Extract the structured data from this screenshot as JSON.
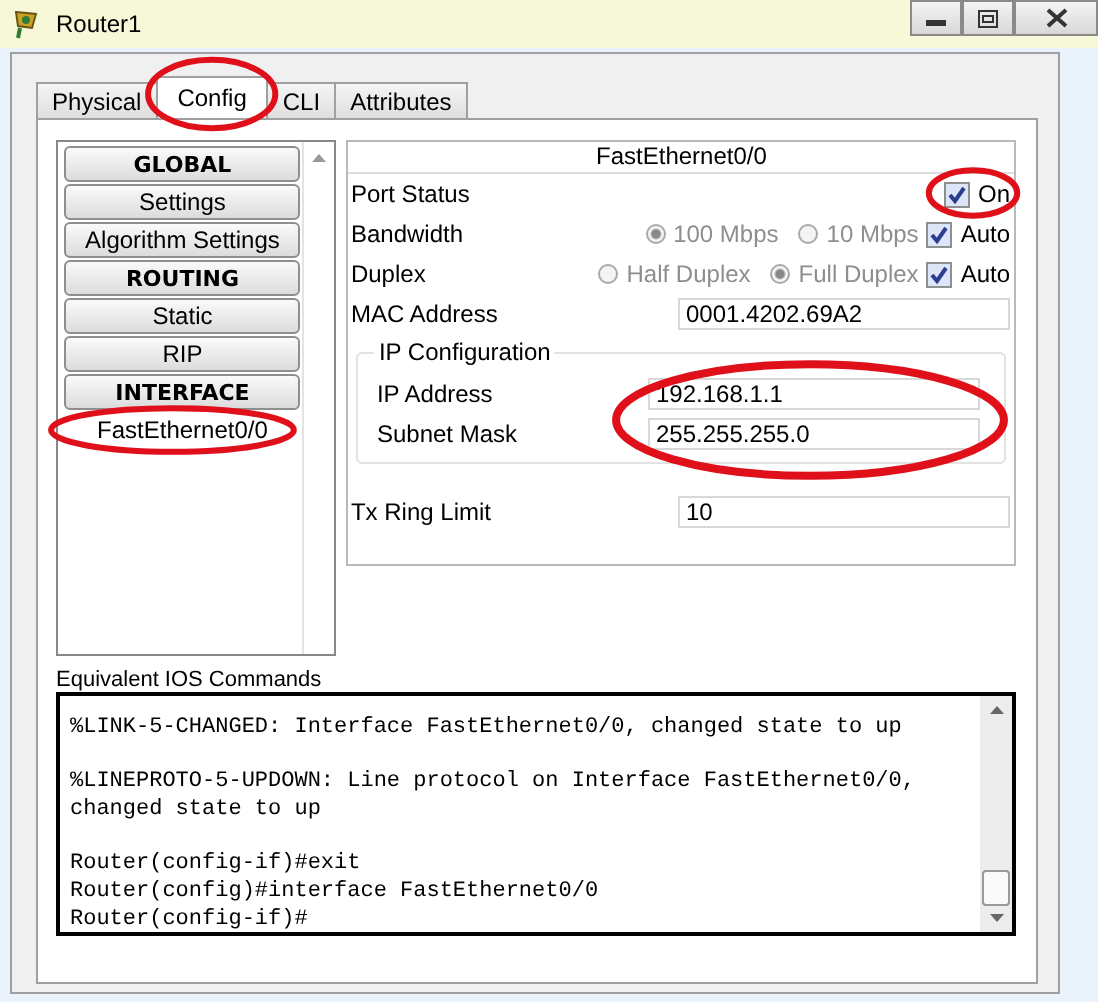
{
  "window": {
    "title": "Router1"
  },
  "tabs": [
    {
      "label": "Physical",
      "selected": false,
      "circled": false
    },
    {
      "label": "Config",
      "selected": true,
      "circled": true
    },
    {
      "label": "CLI",
      "selected": false,
      "circled": false
    },
    {
      "label": "Attributes",
      "selected": false,
      "circled": false
    }
  ],
  "sidebar": {
    "items": [
      {
        "label": "GLOBAL",
        "kind": "header",
        "selected": false,
        "circled": false
      },
      {
        "label": "Settings",
        "kind": "item",
        "selected": false,
        "circled": false
      },
      {
        "label": "Algorithm Settings",
        "kind": "item",
        "selected": false,
        "circled": false
      },
      {
        "label": "ROUTING",
        "kind": "header",
        "selected": false,
        "circled": false
      },
      {
        "label": "Static",
        "kind": "item",
        "selected": false,
        "circled": false
      },
      {
        "label": "RIP",
        "kind": "item",
        "selected": false,
        "circled": false
      },
      {
        "label": "INTERFACE",
        "kind": "header",
        "selected": false,
        "circled": false
      },
      {
        "label": "FastEthernet0/0",
        "kind": "item",
        "selected": true,
        "circled": true
      }
    ]
  },
  "interface": {
    "title": "FastEthernet0/0",
    "port_status": {
      "label": "Port Status",
      "option": "On",
      "checked": true,
      "circled": true
    },
    "bandwidth": {
      "label": "Bandwidth",
      "options": [
        {
          "label": "100 Mbps",
          "selected": true,
          "disabled": true
        },
        {
          "label": "10 Mbps",
          "selected": false,
          "disabled": true
        }
      ],
      "auto": {
        "label": "Auto",
        "checked": true
      }
    },
    "duplex": {
      "label": "Duplex",
      "options": [
        {
          "label": "Half Duplex",
          "selected": false,
          "disabled": true
        },
        {
          "label": "Full Duplex",
          "selected": true,
          "disabled": true
        }
      ],
      "auto": {
        "label": "Auto",
        "checked": true
      }
    },
    "mac": {
      "label": "MAC Address",
      "value": "0001.4202.69A2"
    },
    "ip_configuration": {
      "title": "IP Configuration",
      "circled": true,
      "fields": [
        {
          "label": "IP Address",
          "value": "192.168.1.1"
        },
        {
          "label": "Subnet Mask",
          "value": "255.255.255.0"
        }
      ]
    },
    "tx_ring": {
      "label": "Tx Ring Limit",
      "value": "10"
    }
  },
  "console": {
    "label": "Equivalent IOS Commands",
    "blocks": [
      [
        "%LINK-5-CHANGED: Interface FastEthernet0/0, changed state to up"
      ],
      [
        "%LINEPROTO-5-UPDOWN: Line protocol on Interface FastEthernet0/0,",
        "changed state to up"
      ],
      [
        "Router(config-if)#exit",
        "Router(config)#interface FastEthernet0/0",
        "Router(config-if)#"
      ]
    ]
  }
}
